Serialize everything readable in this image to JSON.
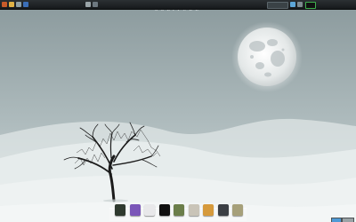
{
  "wallpaper": {
    "title": "SOLITUDE",
    "subtitle": "",
    "corner_text": "",
    "colors": {
      "sky_top": "#8e9da0",
      "sky_bottom": "#c9d3d4",
      "hills": "#e9eeee",
      "moon": "#f2f4f4",
      "tree": "#1b1b1b"
    }
  },
  "top_panel": {
    "menu_text": "",
    "clock": "",
    "icons": [
      "app-menu-icon",
      "home-folder-icon",
      "terminal-icon",
      "browser-icon",
      "settings-icon"
    ]
  },
  "dock": {
    "items": [
      {
        "name": "terminal-icon",
        "color": "#2f3a2f"
      },
      {
        "name": "media-player-icon",
        "color": "#7a56b8"
      },
      {
        "name": "document-viewer-icon",
        "color": "#e8e8ea"
      },
      {
        "name": "clock-app-icon",
        "color": "#101010"
      },
      {
        "name": "system-monitor-icon",
        "color": "#6b7e4a"
      },
      {
        "name": "notes-icon",
        "color": "#c9c4b8"
      },
      {
        "name": "folder-icon",
        "color": "#d69a3c"
      },
      {
        "name": "display-settings-icon",
        "color": "#3b3f44"
      },
      {
        "name": "tools-icon",
        "color": "#a6a07a"
      }
    ]
  }
}
